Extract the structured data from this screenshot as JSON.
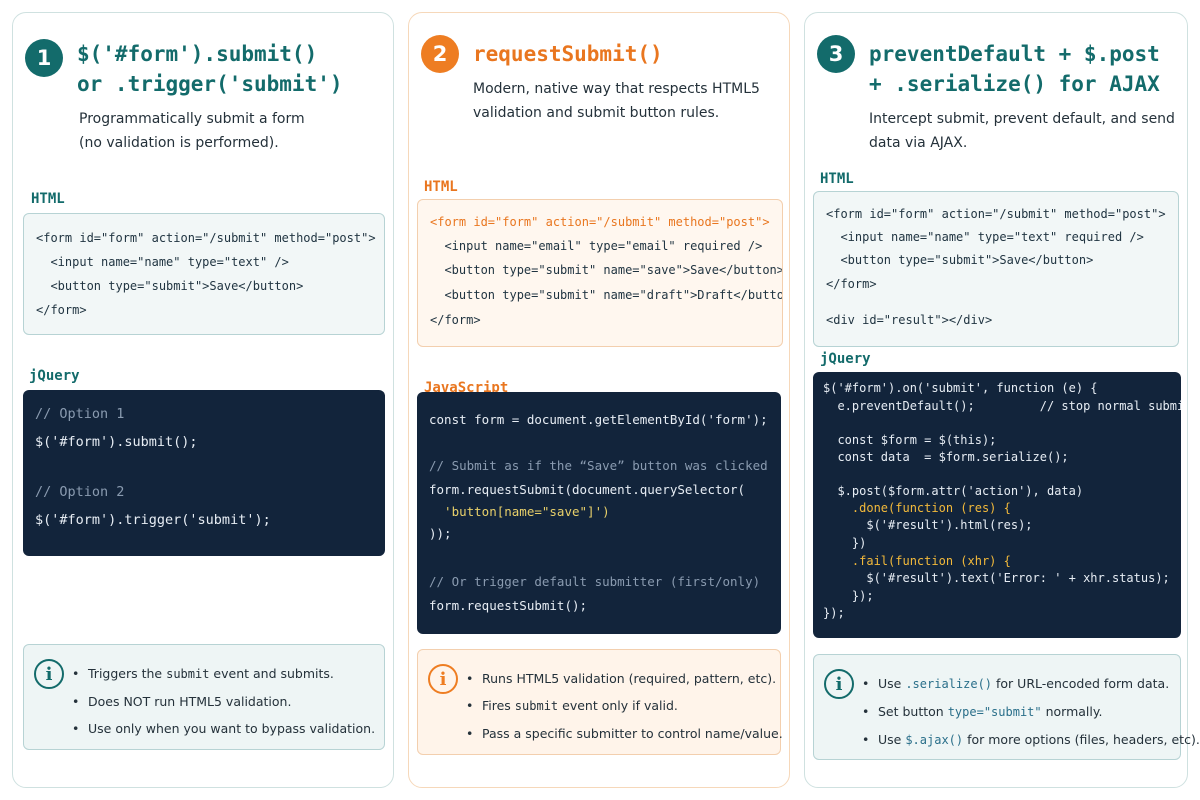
{
  "cards": [
    {
      "number": "1",
      "title": [
        "$('#form').submit()",
        "or .trigger('submit')"
      ],
      "description": [
        "Programmatically submit a form",
        "(no validation is performed)."
      ],
      "html_label": "HTML",
      "html_code": [
        "<form id=\"form\" action=\"/submit\" method=\"post\">",
        "  <input name=\"name\" type=\"text\" />",
        "  <button type=\"submit\">Save</button>",
        "</form>"
      ],
      "js_label": "jQuery",
      "js_code": [
        "// Option 1",
        "$('#form').submit();",
        "",
        "// Option 2",
        "$('#form').trigger('submit');"
      ],
      "notes": [
        [
          "Triggers the ",
          "submit",
          " event and submits."
        ],
        [
          "Does NOT run HTML5 validation."
        ],
        [
          "Use only when you want to bypass validation."
        ]
      ]
    },
    {
      "number": "2",
      "title": [
        "requestSubmit()"
      ],
      "description": [
        "Modern, native way that respects HTML5",
        "validation and submit button rules."
      ],
      "html_label": "HTML",
      "html_code": [
        "<form id=\"form\" action=\"/submit\" method=\"post\">",
        "  <input name=\"email\" type=\"email\" required />",
        "  <button type=\"submit\" name=\"save\">Save</button>",
        "  <button type=\"submit\" name=\"draft\">Draft</button>",
        "</form>"
      ],
      "js_label": "JavaScript",
      "js_code": [
        "const form = document.getElementById('form');",
        "",
        "// Submit as if the “Save” button was clicked",
        "form.requestSubmit(document.querySelector(",
        "  'button[name=\"save\"]')",
        "));",
        "",
        "// Or trigger default submitter (first/only)",
        "form.requestSubmit();"
      ],
      "notes": [
        [
          "Runs HTML5 validation (required, pattern, etc)."
        ],
        [
          "Fires ",
          "submit",
          " event only if valid."
        ],
        [
          "Pass a specific submitter to control name/value."
        ]
      ]
    },
    {
      "number": "3",
      "title": [
        "preventDefault + $.post",
        "+ .serialize() for AJAX"
      ],
      "description": [
        "Intercept submit, prevent default, and send",
        "data via AJAX."
      ],
      "html_label": "HTML",
      "html_code": [
        "<form id=\"form\" action=\"/submit\" method=\"post\">",
        "  <input name=\"name\" type=\"text\" required />",
        "  <button type=\"submit\">Save</button>",
        "</form>",
        "",
        "<div id=\"result\"></div>"
      ],
      "js_label": "jQuery",
      "js_code": [
        "$('#form').on('submit', function (e) {",
        "  e.preventDefault();         // stop normal submit",
        "",
        "  const $form = $(this);",
        "  const data  = $form.serialize();",
        "",
        "  $.post($form.attr('action'), data)",
        "    .done(function (res) {",
        "      $('#result').html(res);",
        "    })",
        "    .fail(function (xhr) {",
        "      $('#result').text('Error: ' + xhr.status);",
        "    });",
        "});"
      ],
      "notes": [
        [
          "Use ",
          ".serialize()",
          " for URL-encoded form data."
        ],
        [
          "Set button ",
          "type=\"submit\"",
          " normally."
        ],
        [
          "Use ",
          "$.ajax()",
          " for more options (files, headers, etc)."
        ]
      ]
    }
  ],
  "colors": {
    "teal": "#136b6b",
    "orange": "#ee7d22",
    "code_dark": "#12243b"
  },
  "icons": {
    "info": "info-icon"
  }
}
